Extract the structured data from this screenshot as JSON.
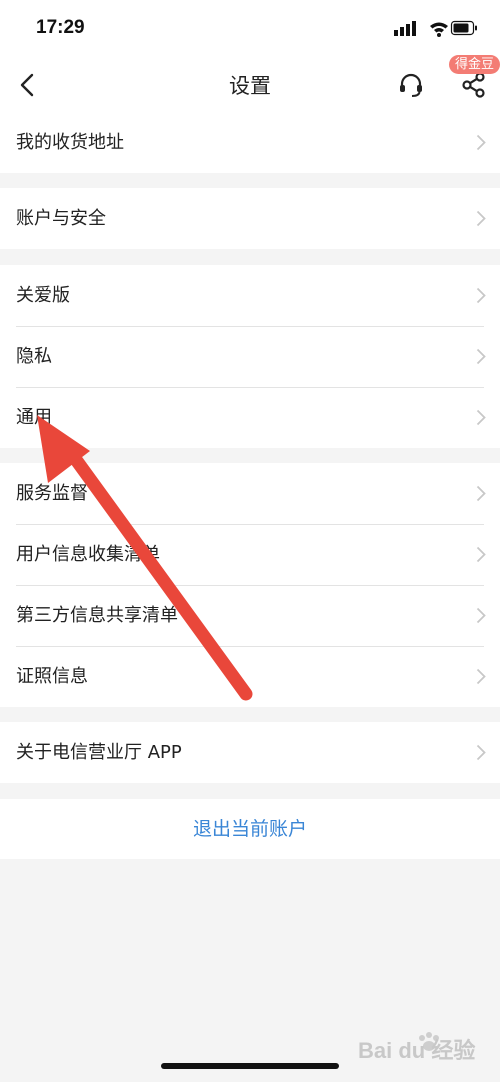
{
  "status_bar": {
    "time": "17:29"
  },
  "nav": {
    "title": "设置",
    "badge": "得金豆"
  },
  "groups": [
    {
      "items": [
        {
          "label": "我的收货地址"
        }
      ]
    },
    {
      "items": [
        {
          "label": "账户与安全"
        }
      ]
    },
    {
      "items": [
        {
          "label": "关爱版"
        },
        {
          "label": "隐私"
        },
        {
          "label": "通用"
        }
      ]
    },
    {
      "items": [
        {
          "label": "服务监督"
        },
        {
          "label": "用户信息收集清单"
        },
        {
          "label": "第三方信息共享清单"
        },
        {
          "label": "证照信息"
        }
      ]
    },
    {
      "items": [
        {
          "label": "关于电信营业厅 APP"
        }
      ]
    }
  ],
  "logout_label": "退出当前账户",
  "watermark": {
    "text": "Bai du 经验"
  },
  "colors": {
    "link": "#3a86d6",
    "badge": "#f37c74",
    "arrow": "#e9473a",
    "background": "#f4f4f4"
  }
}
